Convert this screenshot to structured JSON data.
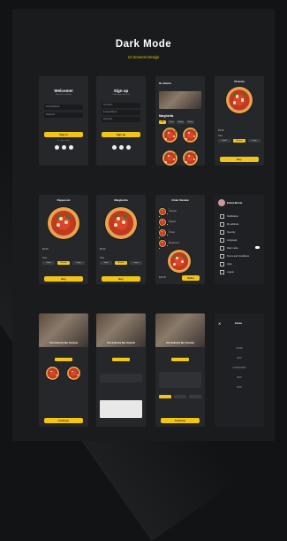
{
  "header": {
    "title": "Dark Mode",
    "subtitle": "12 Screens Design"
  },
  "welcome": {
    "title": "Welcome!",
    "subtitle": "Sign in to continue",
    "email_placeholder": "E-mail Address",
    "password_placeholder": "Password",
    "button": "Sign in",
    "alt": "Or sign in with"
  },
  "signup": {
    "title": "Sign up",
    "subtitle": "Create your account",
    "name_placeholder": "Full Name",
    "email_placeholder": "E-mail Address",
    "password_placeholder": "Password",
    "button": "Sign up"
  },
  "home": {
    "greeting": "Hi, Emma",
    "section": "Margherita",
    "chips": [
      "All",
      "Pizza",
      "Burger",
      "Drinks"
    ]
  },
  "detail1": {
    "title": "Pizzeria",
    "price": "$5.99",
    "size": "Size",
    "sizes": [
      "Small",
      "Medium",
      "Large"
    ],
    "button": "Buy"
  },
  "pepperoni": {
    "title": "Pepperoni",
    "price": "$5.99",
    "size": "Size",
    "sizes": [
      "Small",
      "Medium",
      "Large"
    ],
    "button": "Buy"
  },
  "margherita": {
    "title": "Margherita",
    "price": "$5.99",
    "size": "Size",
    "sizes": [
      "Small",
      "Medium",
      "Large"
    ],
    "button": "Buy"
  },
  "order": {
    "title": "Order Review",
    "items": [
      "Cheese",
      "Pepper",
      "Onion",
      "Mushroom"
    ],
    "total": "$25.00",
    "button": "Order"
  },
  "profile": {
    "name": "Emma Brena",
    "items": [
      "Notification",
      "My address",
      "Security",
      "Language",
      "Dark mode",
      "Terms and Conditions",
      "Help",
      "Logout"
    ]
  },
  "venue": {
    "title": "Port Authority Bus Terminal",
    "button": "Continue"
  },
  "sidemenu": {
    "brand": "Emma",
    "items": [
      "HOME",
      "INFO",
      "CATEGORIES",
      "INFO",
      "INFO"
    ]
  }
}
